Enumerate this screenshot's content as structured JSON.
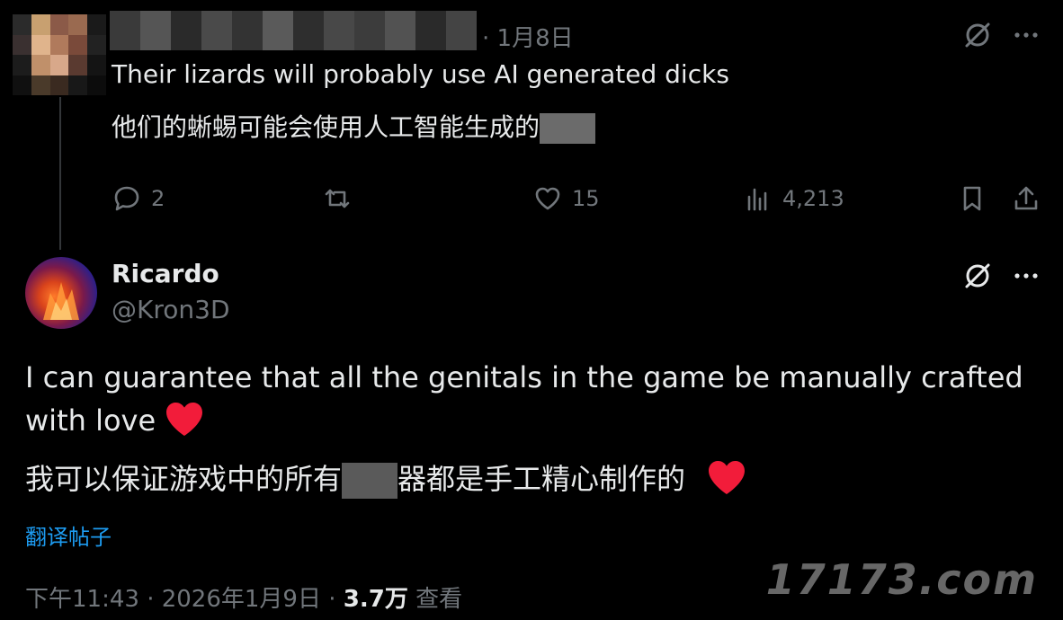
{
  "reply_tweet": {
    "time": "· 1月8日",
    "text_en": "Their lizards will probably use AI generated dicks",
    "text_zh": "他们的蜥蜴可能会使用人工智能生成的",
    "stats": {
      "replies": "2",
      "likes": "15",
      "views": "4,213"
    }
  },
  "main_tweet": {
    "display_name": "Ricardo",
    "handle": "@Kron3D",
    "text_en": "I can guarantee that all the genitals in the game be manually crafted with love",
    "text_zh_a": "我可以保证游戏中的所有",
    "text_zh_b": "器都是手工精心制作的",
    "translate_label": "翻译帖子",
    "timestamp": "下午11:43 · 2026年1月9日 ·",
    "views_count": "3.7万",
    "views_label": "查看"
  },
  "watermark": "17173.com",
  "colors": {
    "background": "#000000",
    "text": "#e7e9ea",
    "muted": "#71767b",
    "link": "#1d9bf0",
    "heart": "#f91880"
  }
}
